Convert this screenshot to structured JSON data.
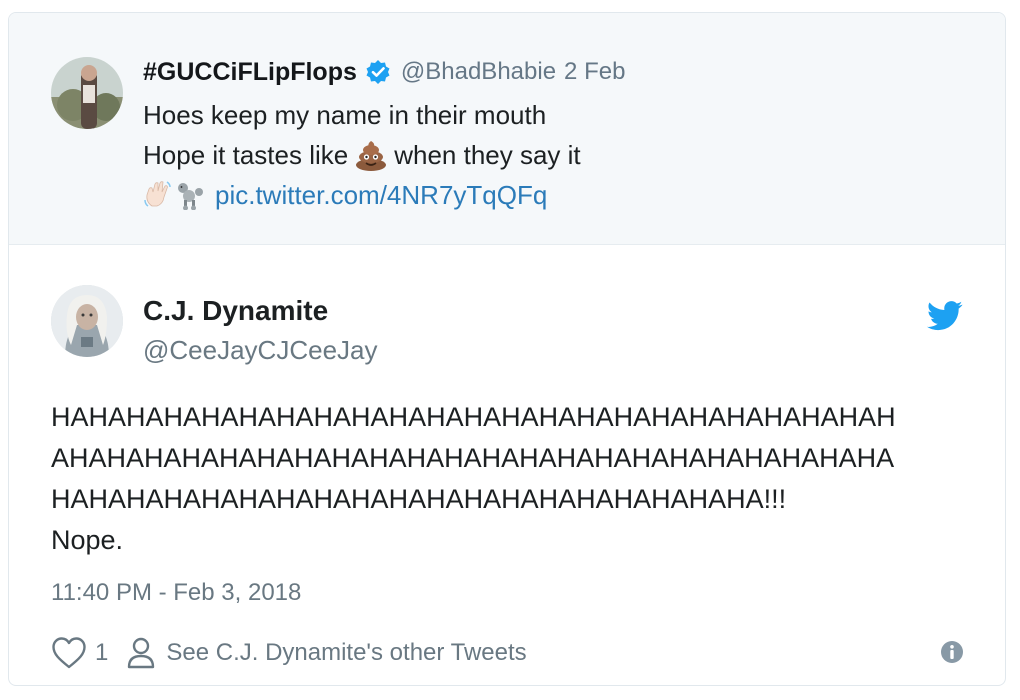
{
  "quoted_tweet": {
    "display_name": "#GUCCiFLipFlops",
    "handle": "@BhadBhabie",
    "date": "2 Feb",
    "line1": "Hoes keep my name in their mouth",
    "line2_before": "Hope it tastes like",
    "line2_after": "when they say it",
    "link": "pic.twitter.com/4NR7yTqQFq",
    "emojis": [
      "poop-emoji",
      "waving-hand-emoji",
      "poodle-emoji"
    ]
  },
  "tweet": {
    "display_name": "C.J. Dynamite",
    "handle": "@CeeJayCJCeeJay",
    "text_lines": [
      "HAHAHAHAHAHAHAHAHAHAHAHAHAHAHAHAHAHAHAHAHAHAH",
      "AHAHAHAHAHAHAHAHAHAHAHAHAHAHAHAHAHAHAHAHAHAHA",
      "HAHAHAHAHAHAHAHAHAHAHAHAHAHAHAHAHAHAHA!!!",
      "Nope."
    ],
    "timestamp": "11:40 PM - Feb 3, 2018",
    "like_count": "1",
    "other_tweets_label": "See C.J. Dynamite's other Tweets"
  },
  "colors": {
    "link": "#2b7bb9",
    "twitter_blue": "#1da1f2",
    "muted": "#697882",
    "quote_bg": "#f5f8fa"
  },
  "icons": [
    "twitter-bird-icon",
    "verified-badge-icon",
    "heart-icon",
    "person-icon",
    "info-icon"
  ]
}
